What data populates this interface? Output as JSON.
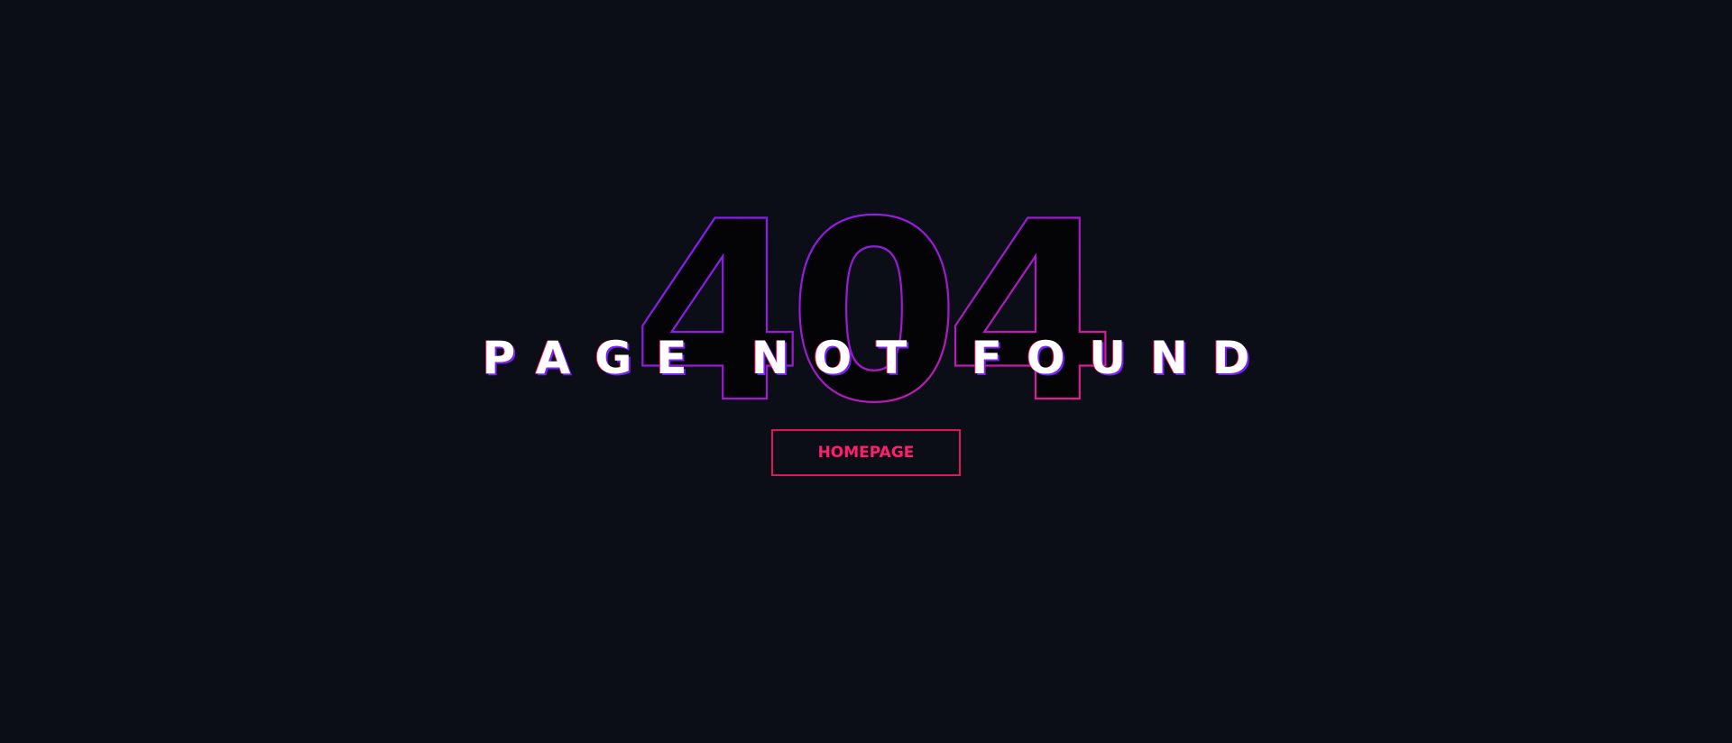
{
  "error": {
    "code": "404",
    "message": "PAGE NOT FOUND"
  },
  "actions": {
    "home_label": "HOMEPAGE"
  },
  "colors": {
    "background": "#0b0e16",
    "outline_purple": "#7a1fff",
    "outline_pink": "#ff1f6b",
    "text": "#ffffff"
  }
}
